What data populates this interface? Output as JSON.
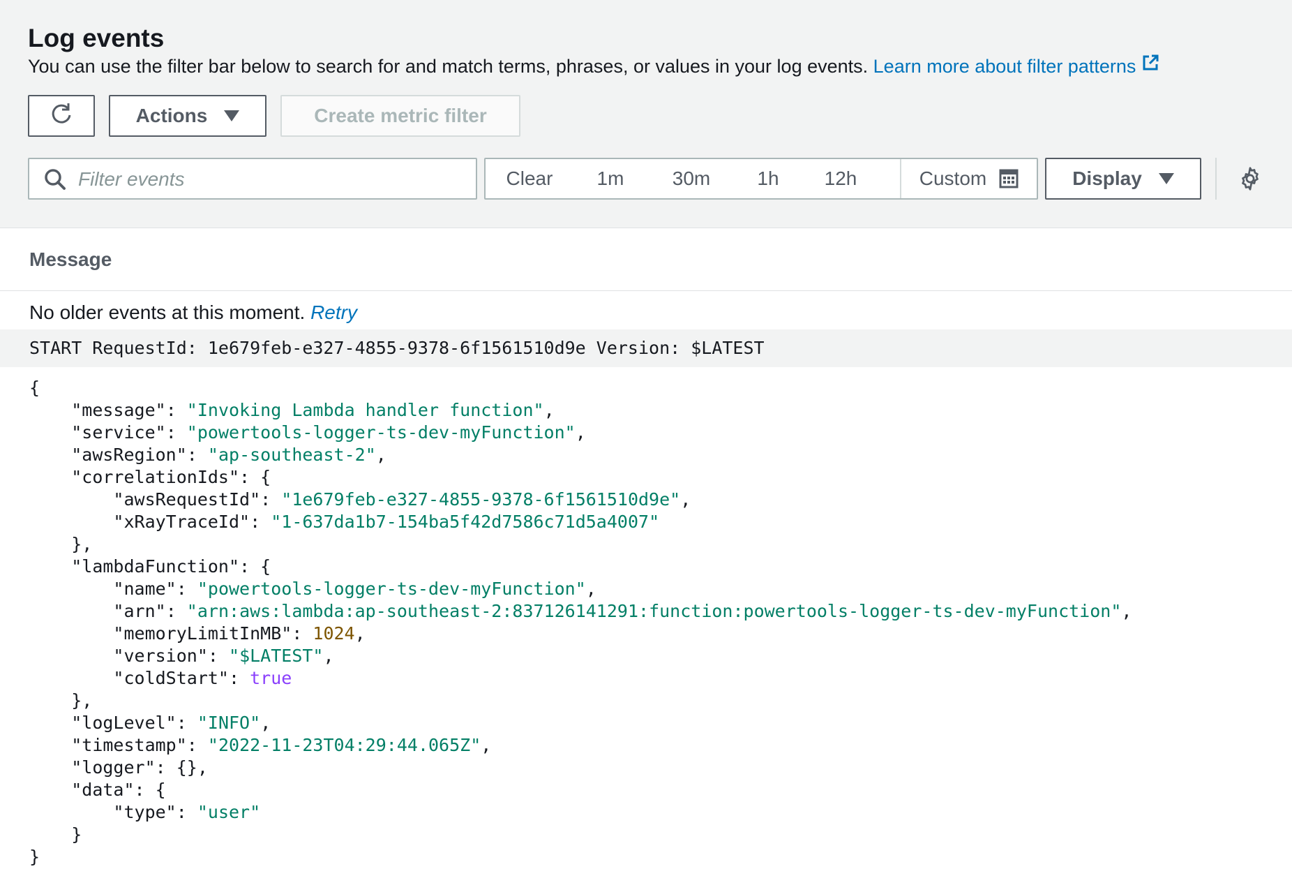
{
  "header": {
    "title": "Log events",
    "description": "You can use the filter bar below to search for and match terms, phrases, or values in your log events.",
    "learn_more": "Learn more about filter patterns"
  },
  "toolbar": {
    "refresh_icon": "refresh-icon",
    "actions_label": "Actions",
    "create_metric_label": "Create metric filter"
  },
  "filter": {
    "search_icon": "search-icon",
    "placeholder": "Filter events",
    "ranges": [
      "Clear",
      "1m",
      "30m",
      "1h",
      "12h"
    ],
    "custom_label": "Custom",
    "display_label": "Display",
    "settings_icon": "gear-icon"
  },
  "table": {
    "column_header": "Message",
    "no_older": "No older events at this moment.",
    "retry": "Retry",
    "start_line": "START RequestId: 1e679feb-e327-4855-9378-6f1561510d9e Version: $LATEST"
  },
  "log_json": {
    "message": "Invoking Lambda handler function",
    "service": "powertools-logger-ts-dev-myFunction",
    "awsRegion": "ap-southeast-2",
    "correlationIds": {
      "awsRequestId": "1e679feb-e327-4855-9378-6f1561510d9e",
      "xRayTraceId": "1-637da1b7-154ba5f42d7586c71d5a4007"
    },
    "lambdaFunction": {
      "name": "powertools-logger-ts-dev-myFunction",
      "arn": "arn:aws:lambda:ap-southeast-2:837126141291:function:powertools-logger-ts-dev-myFunction",
      "memoryLimitInMB": "1024",
      "version": "$LATEST",
      "coldStart": "true"
    },
    "logLevel": "INFO",
    "timestamp": "2022-11-23T04:29:44.065Z",
    "logger": "{}",
    "data": {
      "type": "user"
    }
  }
}
